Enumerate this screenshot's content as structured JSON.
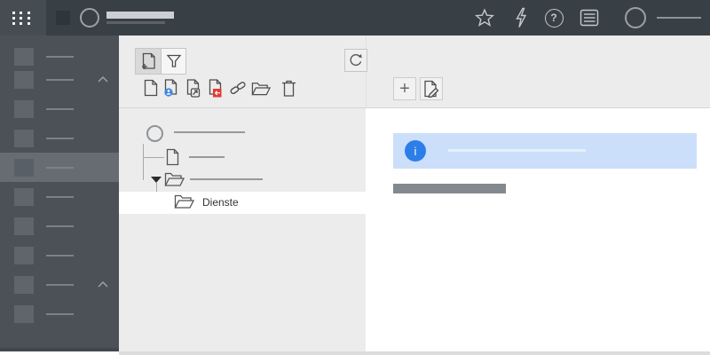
{
  "colors": {
    "topbar_bg": "#394045",
    "sidebar_bg": "#4b5157",
    "sidebar_active_bg": "#666c71",
    "panel_bg": "#ececec",
    "selected_row_bg": "#ffffff",
    "accent_blue": "#2d7ee9",
    "info_banner_bg": "#cbdffa",
    "badge_blue": "#3b82e8",
    "badge_red": "#e23b32"
  },
  "topbar": {
    "launcher_icon": "app-grid-dots",
    "logo_icon": "logo-square-placeholder",
    "brand_icon": "brand-circle-outline",
    "title_placeholder": true,
    "action_icons": [
      "star",
      "lightning",
      "question-circle",
      "list-panel",
      "avatar-circle"
    ],
    "help_glyph": "?"
  },
  "sidebar": {
    "items": [
      {
        "icon": "square-placeholder",
        "chevron": false,
        "active": false
      },
      {
        "icon": "square-placeholder",
        "chevron": true,
        "active": false
      },
      {
        "icon": "square-placeholder",
        "chevron": false,
        "active": false
      },
      {
        "icon": "square-placeholder",
        "chevron": false,
        "active": false
      },
      {
        "icon": "square-placeholder",
        "chevron": false,
        "active": true
      },
      {
        "icon": "square-placeholder",
        "chevron": false,
        "active": false
      },
      {
        "icon": "square-placeholder",
        "chevron": false,
        "active": false
      },
      {
        "icon": "square-placeholder",
        "chevron": false,
        "active": false
      },
      {
        "icon": "square-placeholder",
        "chevron": true,
        "active": false
      },
      {
        "icon": "square-placeholder",
        "chevron": false,
        "active": false
      }
    ]
  },
  "toolbar": {
    "mode_buttons": [
      {
        "name": "add-document",
        "icon": "document-plus",
        "selected": true
      },
      {
        "name": "filter",
        "icon": "funnel",
        "selected": false
      }
    ],
    "refresh_button": {
      "icon": "refresh-arrow"
    },
    "document_actions": [
      {
        "name": "new-document",
        "icon": "document"
      },
      {
        "name": "document-user",
        "icon": "document-user-badge"
      },
      {
        "name": "document-forward",
        "icon": "document-arrow-badge"
      },
      {
        "name": "document-import",
        "icon": "document-red-arrow-badge"
      },
      {
        "name": "link",
        "icon": "chain-link"
      },
      {
        "name": "folder",
        "icon": "folder-open"
      },
      {
        "name": "delete",
        "icon": "trash"
      }
    ],
    "right_buttons": [
      {
        "name": "add",
        "glyph": "+"
      },
      {
        "name": "edit",
        "icon": "document-pencil"
      }
    ]
  },
  "tree": {
    "items": [
      {
        "level": 0,
        "icon": "circle",
        "label_placeholder": true
      },
      {
        "level": 1,
        "icon": "document",
        "label_placeholder": true
      },
      {
        "level": 1,
        "icon": "folder-open",
        "expanded": true,
        "label_placeholder": true
      },
      {
        "level": 2,
        "icon": "folder-open",
        "label": "Dienste",
        "selected": true
      }
    ]
  },
  "content": {
    "info_banner": {
      "icon": "info-circle",
      "glyph": "i",
      "text_placeholder": true
    },
    "heading_placeholder": true
  }
}
